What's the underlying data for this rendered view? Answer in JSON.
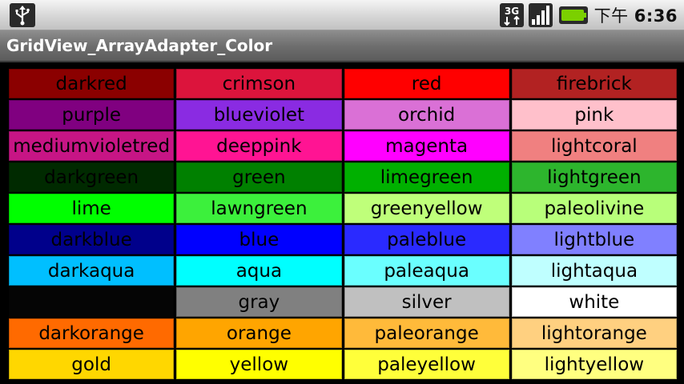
{
  "status_bar": {
    "usb_icon": "usb-icon",
    "network_label": "3G",
    "signal_icon": "signal-icon",
    "battery_icon": "battery-icon",
    "battery_color": "#7bd000",
    "time_prefix": "下午 ",
    "time": "6:36"
  },
  "title_bar": {
    "title": "GridView_ArrayAdapter_Color"
  },
  "grid": {
    "items": [
      {
        "label": "darkred",
        "color": "#8b0000"
      },
      {
        "label": "crimson",
        "color": "#dc143c"
      },
      {
        "label": "red",
        "color": "#ff0000"
      },
      {
        "label": "firebrick",
        "color": "#b22222"
      },
      {
        "label": "purple",
        "color": "#800080"
      },
      {
        "label": "blueviolet",
        "color": "#8a2be2"
      },
      {
        "label": "orchid",
        "color": "#da70d6"
      },
      {
        "label": "pink",
        "color": "#ffc0cb"
      },
      {
        "label": "mediumvioletred",
        "color": "#c71585"
      },
      {
        "label": "deeppink",
        "color": "#ff1493"
      },
      {
        "label": "magenta",
        "color": "#ff00ff"
      },
      {
        "label": "lightcoral",
        "color": "#f08080"
      },
      {
        "label": "darkgreen",
        "color": "#002a00"
      },
      {
        "label": "green",
        "color": "#008000"
      },
      {
        "label": "limegreen",
        "color": "#00b000"
      },
      {
        "label": "lightgreen",
        "color": "#2db52d"
      },
      {
        "label": "lime",
        "color": "#00ff00"
      },
      {
        "label": "lawngreen",
        "color": "#3cf03c"
      },
      {
        "label": "greenyellow",
        "color": "#bfff7a"
      },
      {
        "label": "paleolivine",
        "color": "#b8ff7a"
      },
      {
        "label": "darkblue",
        "color": "#00008b"
      },
      {
        "label": "blue",
        "color": "#0000ff"
      },
      {
        "label": "paleblue",
        "color": "#2a2aff"
      },
      {
        "label": "lightblue",
        "color": "#8080ff"
      },
      {
        "label": "darkaqua",
        "color": "#00bfff"
      },
      {
        "label": "aqua",
        "color": "#00ffff"
      },
      {
        "label": "paleaqua",
        "color": "#6affff"
      },
      {
        "label": "lightaqua",
        "color": "#bfffff"
      },
      {
        "label": "",
        "color": "#050505"
      },
      {
        "label": "gray",
        "color": "#808080"
      },
      {
        "label": "silver",
        "color": "#c0c0c0"
      },
      {
        "label": "white",
        "color": "#ffffff"
      },
      {
        "label": "darkorange",
        "color": "#ff6a00"
      },
      {
        "label": "orange",
        "color": "#ffa500"
      },
      {
        "label": "paleorange",
        "color": "#ffba3a"
      },
      {
        "label": "lightorange",
        "color": "#ffd080"
      },
      {
        "label": "gold",
        "color": "#ffd700"
      },
      {
        "label": "yellow",
        "color": "#ffff00"
      },
      {
        "label": "paleyellow",
        "color": "#ffff3a"
      },
      {
        "label": "lightyellow",
        "color": "#ffff80"
      }
    ]
  }
}
